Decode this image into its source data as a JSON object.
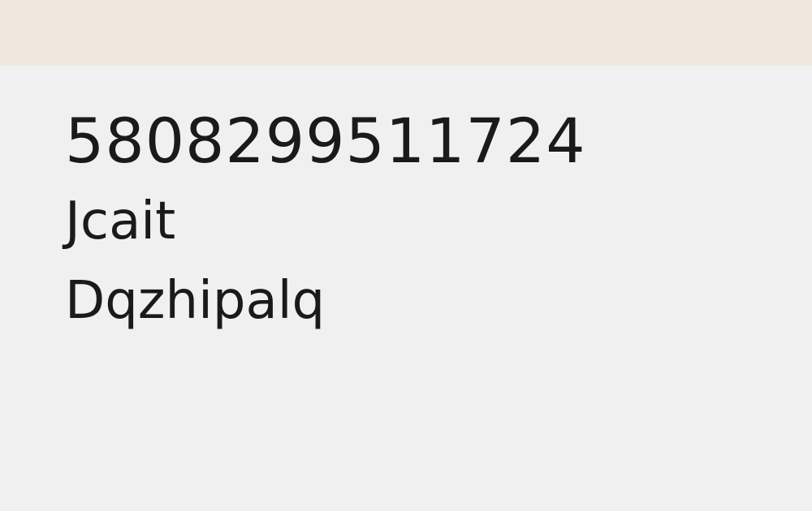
{
  "lines": {
    "number": "5808299511724",
    "name_first": "Jcait",
    "name_second": "Dqzhipalq"
  },
  "colors": {
    "top_bar": "#f0e7df",
    "background": "#f0f0f0",
    "text": "#1a1a1a"
  }
}
